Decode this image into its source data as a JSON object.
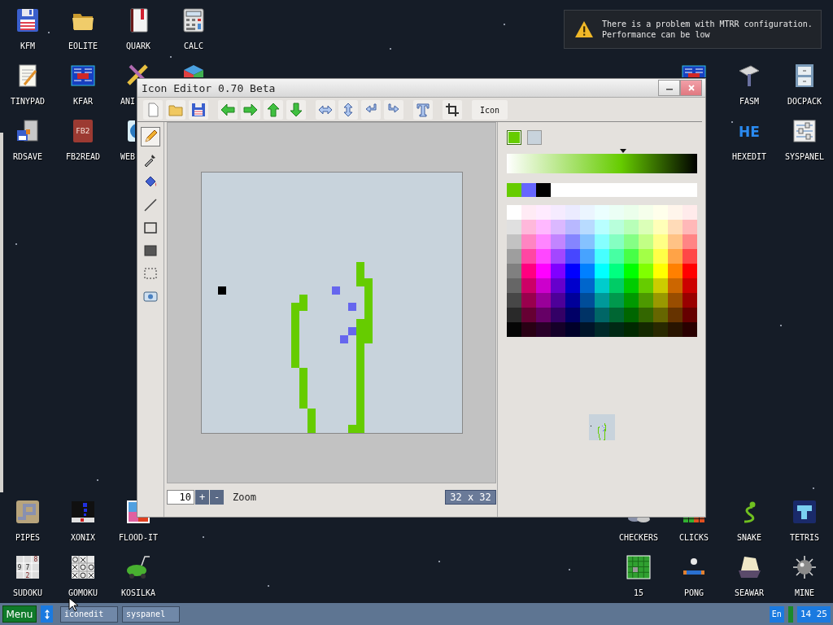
{
  "desktop": {
    "top_left": [
      [
        {
          "kind": "floppy",
          "label": "KFM"
        },
        {
          "kind": "folder",
          "label": "EOLITE"
        },
        {
          "kind": "book",
          "label": "QUARK"
        },
        {
          "kind": "calculator",
          "label": "CALC"
        }
      ],
      [
        {
          "kind": "notepad",
          "label": "TINYPAD"
        },
        {
          "kind": "kfar",
          "label": "KFAR"
        },
        {
          "kind": "tools",
          "label": "ANI"
        },
        {
          "kind": "cube"
        }
      ],
      [
        {
          "kind": "rdsave",
          "label": "RDSAVE"
        },
        {
          "kind": "fb2",
          "label": "FB2READ",
          "glyph": "FB2"
        },
        {
          "kind": "web",
          "label": "WEB"
        }
      ]
    ],
    "top_right": [
      [
        {
          "kind": "kfar"
        },
        {
          "kind": "hammer",
          "label": "FASM"
        },
        {
          "kind": "cabinet",
          "label": "DOCPACK"
        }
      ],
      [
        {
          "kind": "hex",
          "label": "HEXEDIT",
          "glyph": "HE"
        },
        {
          "kind": "sliders",
          "label": "SYSPANEL"
        }
      ]
    ],
    "bottom_left": [
      [
        {
          "kind": "pipes",
          "label": "PIPES"
        },
        {
          "kind": "xonix",
          "label": "XONIX"
        },
        {
          "kind": "flood",
          "label": "FLOOD-IT"
        }
      ],
      [
        {
          "kind": "sudoku",
          "label": "SUDOKU",
          "digits": [
            "8",
            "9",
            "7",
            "2"
          ]
        },
        {
          "kind": "gomoku",
          "label": "GOMOKU"
        },
        {
          "kind": "mower",
          "label": "KOSILKA"
        }
      ]
    ],
    "bottom_right": [
      [
        {
          "kind": "checkers",
          "label": "CHECKERS"
        },
        {
          "kind": "clicks",
          "label": "CLICKS"
        },
        {
          "kind": "snake",
          "label": "SNAKE"
        },
        {
          "kind": "tetris",
          "label": "TETRIS"
        }
      ],
      [
        {
          "kind": "fifteen",
          "label": "15"
        },
        {
          "kind": "pong",
          "label": "PONG"
        },
        {
          "kind": "ship",
          "label": "SEAWAR"
        },
        {
          "kind": "mine",
          "label": "MINE"
        }
      ]
    ]
  },
  "notification": {
    "lines": [
      "There is a problem with MTRR configuration.",
      "Performance can be low"
    ]
  },
  "editor": {
    "title": "Icon Editor 0.70 Beta",
    "toolbar": [
      [
        {
          "kind": "new"
        },
        {
          "kind": "open"
        },
        {
          "kind": "save"
        }
      ],
      [
        {
          "kind": "left"
        },
        {
          "kind": "right"
        },
        {
          "kind": "up"
        },
        {
          "kind": "down"
        }
      ],
      [
        {
          "kind": "flip_h"
        },
        {
          "kind": "flip_v"
        },
        {
          "kind": "rotate_left"
        },
        {
          "kind": "rotate_right"
        }
      ],
      [
        {
          "kind": "text"
        }
      ],
      [
        {
          "kind": "crop"
        }
      ],
      [
        {
          "kind": "label",
          "label": "Icon"
        }
      ]
    ],
    "tools": [
      {
        "kind": "pencil",
        "selected": true
      },
      {
        "kind": "pipette",
        "selected": false
      },
      {
        "kind": "fill",
        "selected": false
      },
      {
        "kind": "line",
        "selected": false
      },
      {
        "kind": "rect",
        "selected": false
      },
      {
        "kind": "filled_rect",
        "selected": false
      },
      {
        "kind": "select",
        "selected": false
      },
      {
        "kind": "screenshot",
        "selected": false
      }
    ],
    "swatches": [
      {
        "color": "#66cc00",
        "selected": true
      },
      {
        "color": "#c8d3dc",
        "selected": false
      }
    ],
    "shade": {
      "level": 0.61
    },
    "recent_colors": [
      {
        "color": "#66cc00"
      },
      {
        "color": "#6666ff"
      },
      {
        "color": "#000000"
      }
    ],
    "zoom": {
      "value": "10",
      "plus": "+",
      "minus": "-",
      "label": "Zoom"
    },
    "size": "32 x 32"
  },
  "taskbar": {
    "menu": "Menu",
    "tasks": [
      "iconedit",
      "syspanel"
    ],
    "language": "En",
    "clock": "14 25"
  }
}
